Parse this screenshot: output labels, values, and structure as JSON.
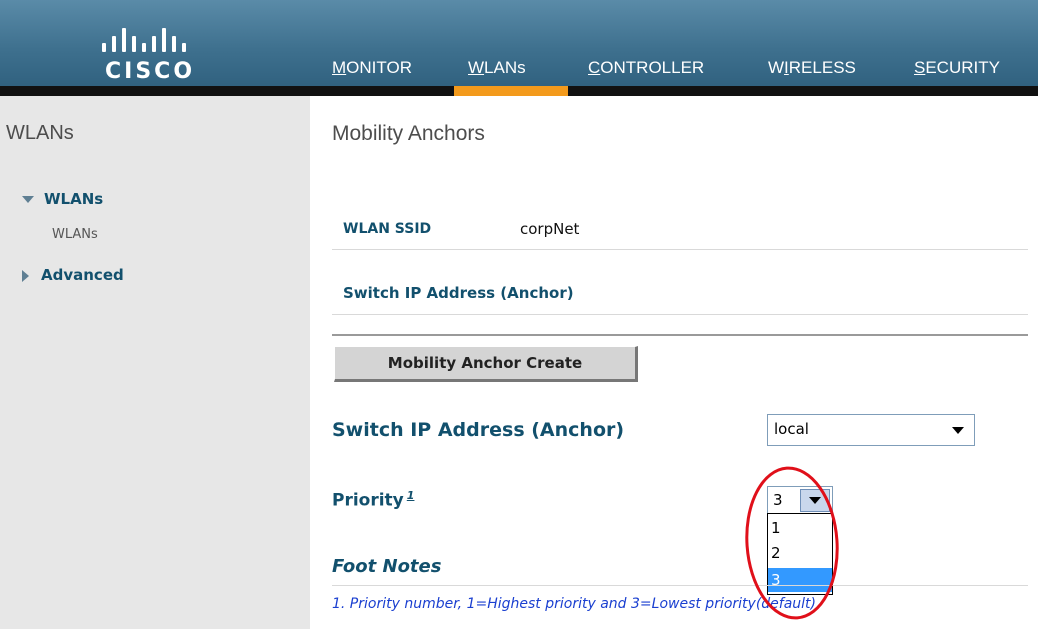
{
  "header": {
    "logo_text": "CISCO",
    "nav": [
      {
        "label": "MONITOR",
        "underline_char": "M"
      },
      {
        "label": "WLANs",
        "underline_char": "W"
      },
      {
        "label": "CONTROLLER",
        "underline_char": "C"
      },
      {
        "label": "WIRELESS",
        "underline_char": "I"
      },
      {
        "label": "SECURITY",
        "underline_char": "S"
      }
    ],
    "active_tab": "WLANs",
    "active_color": "#f39a1c"
  },
  "sidebar": {
    "title": "WLANs",
    "groups": [
      {
        "label": "WLANs",
        "expanded": true,
        "children": [
          "WLANs"
        ]
      },
      {
        "label": "Advanced",
        "expanded": false
      }
    ]
  },
  "main": {
    "page_title": "Mobility Anchors",
    "wlan_ssid_label": "WLAN SSID",
    "wlan_ssid_value": "corpNet",
    "anchor_header": "Switch IP Address (Anchor)",
    "create_button": "Mobility Anchor Create",
    "switch_ip_label": "Switch IP Address (Anchor)",
    "switch_ip_selected": "local",
    "priority_label": "Priority",
    "priority_footnote_ref": "1",
    "priority_selected": "3",
    "priority_options": [
      "1",
      "2",
      "3"
    ],
    "footnotes_title": "Foot Notes",
    "footnote_1": "1. Priority number, 1=Highest priority and 3=Lowest priority(default)."
  },
  "colors": {
    "label_blue": "#12506d",
    "highlight_red": "#e0101a",
    "option_selected": "#3399ff"
  }
}
